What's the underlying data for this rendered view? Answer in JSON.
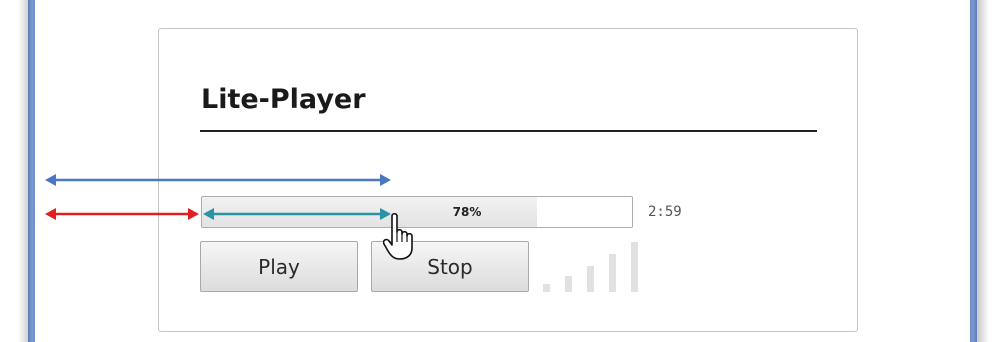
{
  "app": {
    "title": "Lite-Player"
  },
  "playback": {
    "progress_percent": 78,
    "progress_label": "78%",
    "time_display": "2:59"
  },
  "controls": {
    "play_label": "Play",
    "stop_label": "Stop"
  },
  "volume": {
    "bar_count": 5
  },
  "annotations": {
    "arrow_colors": {
      "blue": "#4a76c2",
      "red": "#e02020",
      "teal": "#2b93a6"
    }
  },
  "icons": {
    "cursor": "hand-pointer-icon"
  }
}
